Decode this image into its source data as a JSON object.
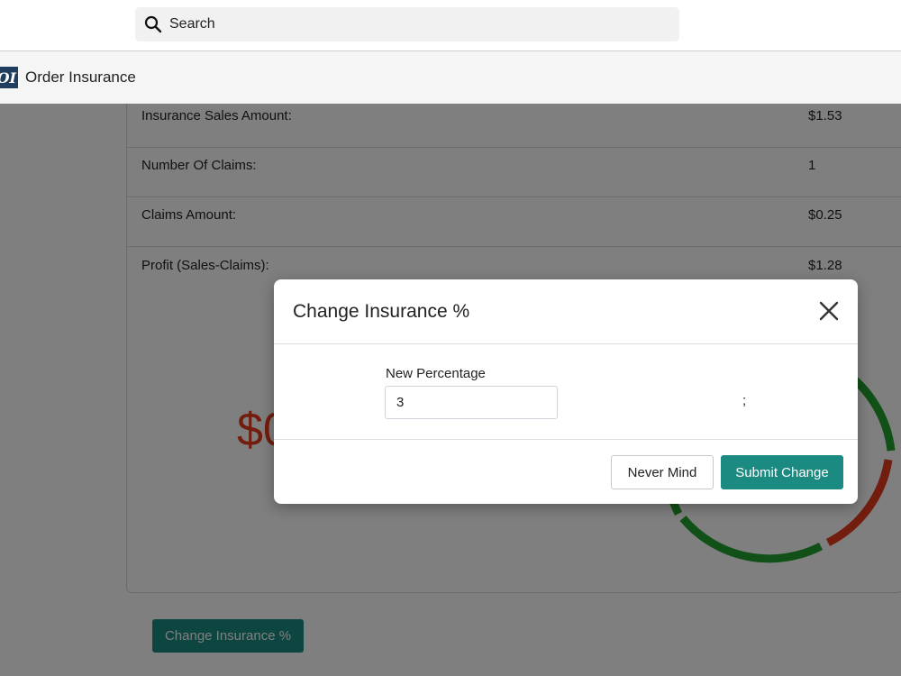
{
  "search": {
    "placeholder": "Search",
    "icon": "search-icon"
  },
  "app": {
    "title": "Order Insurance",
    "logo_text": "OI",
    "logo_color": "#1f3d5c"
  },
  "stats": [
    {
      "label": "Insurance Sales Amount:",
      "value": "$1.53"
    },
    {
      "label": "Number Of Claims:",
      "value": "1"
    },
    {
      "label": "Claims Amount:",
      "value": "$0.25"
    },
    {
      "label": "Profit (Sales-Claims):",
      "value": "$1.28"
    }
  ],
  "summary": {
    "amount_partial": "$0",
    "amount_color": "#e53a1a"
  },
  "donut": {
    "green_color": "#23a02d",
    "red_color": "#e53a1a"
  },
  "actions": {
    "change_label": "Change Insurance %"
  },
  "modal": {
    "title": "Change Insurance %",
    "close_icon": "close-icon",
    "field_label": "New Percentage",
    "field_value": "3",
    "stray_text": ";",
    "cancel_label": "Never Mind",
    "submit_label": "Submit Change"
  },
  "colors": {
    "accent": "#1b8a80",
    "overlay": "rgba(0,0,0,0.5)"
  }
}
